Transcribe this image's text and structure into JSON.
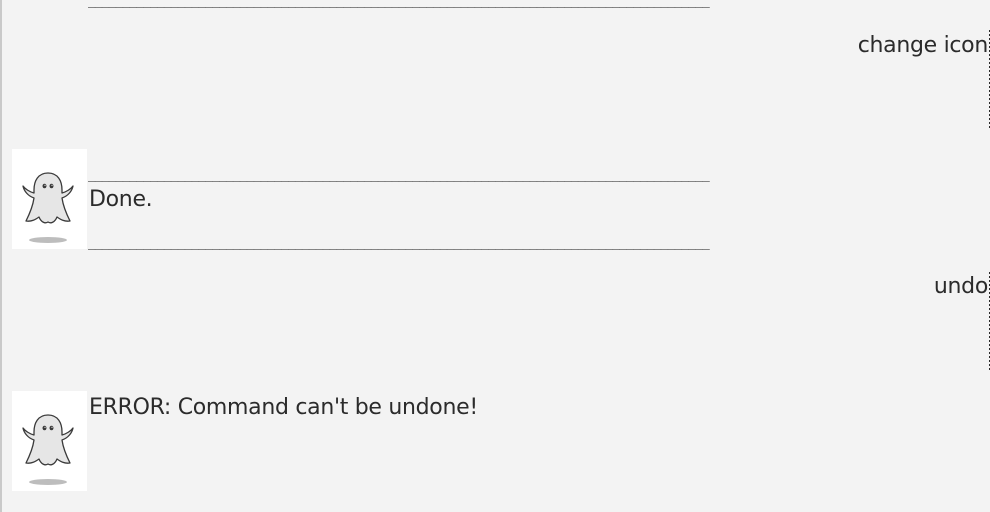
{
  "chat": {
    "divider": "__________________________________________________________________________________________",
    "user_messages": [
      "change icon",
      "undo"
    ],
    "bot_messages": [
      "Done.",
      "ERROR: Command can't be undone!"
    ]
  },
  "avatar": {
    "icon": "ghost-icon"
  }
}
